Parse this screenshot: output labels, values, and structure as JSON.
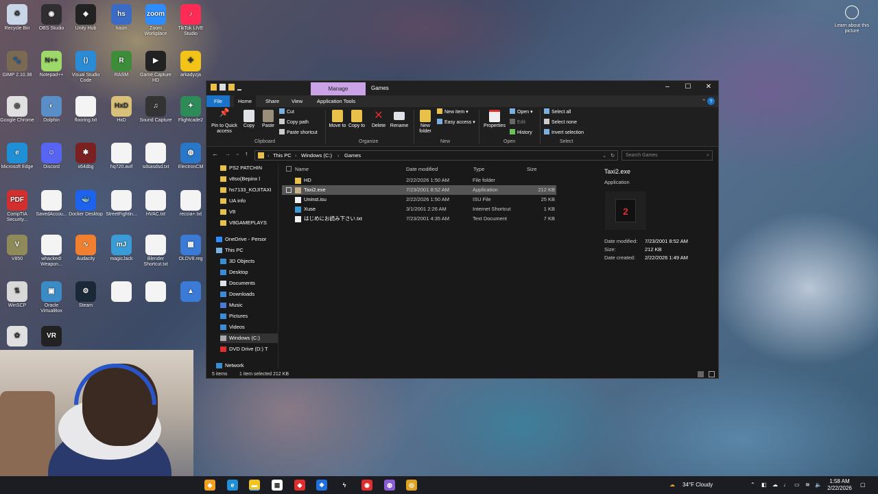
{
  "desktop": {
    "icons": [
      {
        "label": "Recycle Bin",
        "color": "#c9d6e8",
        "glyph": "♻"
      },
      {
        "label": "OBS Studio",
        "color": "#302e31",
        "glyph": "◉"
      },
      {
        "label": "Unity Hub",
        "color": "#222222",
        "glyph": "◈"
      },
      {
        "label": "hasm",
        "color": "#3b6bc4",
        "glyph": "hs"
      },
      {
        "label": "Zoom Workplace",
        "color": "#2d8cff",
        "glyph": "zoom"
      },
      {
        "label": "TikTok LIVE Studio",
        "color": "#fe2c55",
        "glyph": "♪"
      },
      {
        "label": "GIMP 2.10.38",
        "color": "#7a6a54",
        "glyph": "🐾"
      },
      {
        "label": "Notepad++",
        "color": "#9ed86a",
        "glyph": "N++"
      },
      {
        "label": "Visual Studio Code",
        "color": "#2a8bd6",
        "glyph": "⟨⟩"
      },
      {
        "label": "RASM",
        "color": "#3d8c3a",
        "glyph": "R"
      },
      {
        "label": "Game Capture HD",
        "color": "#222222",
        "glyph": "▶"
      },
      {
        "label": "arkadyzja",
        "color": "#f2c318",
        "glyph": "✚"
      },
      {
        "label": "Google Chrome",
        "color": "#e0e0e0",
        "glyph": "◎"
      },
      {
        "label": "Dolphin",
        "color": "#5a8ec6",
        "glyph": "◐"
      },
      {
        "label": "flooring.txt",
        "color": "#f4f4f4",
        "glyph": ""
      },
      {
        "label": "HxD",
        "color": "#d8c07a",
        "glyph": "HxD"
      },
      {
        "label": "Sound Capture",
        "color": "#333333",
        "glyph": "♫"
      },
      {
        "label": "Flightcade2",
        "color": "#2e8b57",
        "glyph": "✦"
      },
      {
        "label": "Microsoft Edge",
        "color": "#1f8fd6",
        "glyph": "e"
      },
      {
        "label": "Discord",
        "color": "#5865f2",
        "glyph": "☺"
      },
      {
        "label": "x64dbg",
        "color": "#7a2020",
        "glyph": "✱"
      },
      {
        "label": "hq720.avif",
        "color": "#f4f4f4",
        "glyph": ""
      },
      {
        "label": "sdsasdsd.txt",
        "color": "#f4f4f4",
        "glyph": ""
      },
      {
        "label": "ElectronCM",
        "color": "#2a76c8",
        "glyph": "◍"
      },
      {
        "label": "CompTIA Security...",
        "color": "#d32f2f",
        "glyph": "PDF"
      },
      {
        "label": "SavedAccou...",
        "color": "#f4f4f4",
        "glyph": ""
      },
      {
        "label": "Docker Desktop",
        "color": "#1d63ed",
        "glyph": "🐳"
      },
      {
        "label": "StreetFightin...",
        "color": "#f4f4f4",
        "glyph": ""
      },
      {
        "label": "HVAC.txt",
        "color": "#f4f4f4",
        "glyph": ""
      },
      {
        "label": "reccia+.txt",
        "color": "#f4f4f4",
        "glyph": ""
      },
      {
        "label": "V850",
        "color": "#8f8a5a",
        "glyph": "V"
      },
      {
        "label": "whacked! Weapon...",
        "color": "#f4f4f4",
        "glyph": ""
      },
      {
        "label": "Audacity",
        "color": "#f08030",
        "glyph": "∿"
      },
      {
        "label": "magicJack",
        "color": "#3b9bd6",
        "glyph": "mJ"
      },
      {
        "label": "Blender Shortcut.txt",
        "color": "#f4f4f4",
        "glyph": ""
      },
      {
        "label": "OLDV8.reg",
        "color": "#3b7bd6",
        "glyph": "▦"
      },
      {
        "label": "WinSCP",
        "color": "#d8d8d8",
        "glyph": "⇅"
      },
      {
        "label": "Oracle VirtualBox",
        "color": "#3b8cc6",
        "glyph": "▣"
      },
      {
        "label": "Steam",
        "color": "#1b2838",
        "glyph": "⚙"
      },
      {
        "label": "",
        "color": "#f4f4f4",
        "glyph": ""
      },
      {
        "label": "",
        "color": "#f4f4f4",
        "glyph": ""
      },
      {
        "label": "",
        "color": "#3b7bd6",
        "glyph": "▲"
      },
      {
        "label": "",
        "color": "#e0e0e0",
        "glyph": "✿"
      },
      {
        "label": "",
        "color": "#222222",
        "glyph": "VR"
      }
    ],
    "learn_label": "Learn about this picture"
  },
  "explorer": {
    "context_tab": "Manage",
    "title": "Games",
    "tabs": [
      "File",
      "Home",
      "Share",
      "View",
      "Application Tools"
    ],
    "ribbon": {
      "pin": "Pin to Quick access",
      "copy": "Copy",
      "paste": "Paste",
      "cut": "Cut",
      "copy_path": "Copy path",
      "paste_shortcut": "Paste shortcut",
      "move_to": "Move to",
      "copy_to": "Copy to",
      "delete": "Delete",
      "rename": "Rename",
      "new_folder": "New folder",
      "new_item": "New item",
      "easy_access": "Easy access",
      "properties": "Properties",
      "open": "Open",
      "edit": "Edit",
      "history": "History",
      "select_all": "Select all",
      "select_none": "Select none",
      "invert_selection": "Invert selection",
      "groups": [
        "Clipboard",
        "Organize",
        "New",
        "Open",
        "Select"
      ]
    },
    "address": {
      "crumbs": [
        "This PC",
        "Windows (C:)",
        "Games"
      ],
      "search_placeholder": "Search Games"
    },
    "nav": [
      {
        "label": "PS2 PATCHIN",
        "indent": 1,
        "icon": "folder"
      },
      {
        "label": "v8so(Bepinx l",
        "indent": 1,
        "icon": "folder"
      },
      {
        "label": "hs7133_KOJITAXI",
        "indent": 1,
        "icon": "folder"
      },
      {
        "label": "UA info",
        "indent": 1,
        "icon": "folder"
      },
      {
        "label": "V8",
        "indent": 1,
        "icon": "folder"
      },
      {
        "label": "V8GAMEPLAYS",
        "indent": 1,
        "icon": "folder"
      },
      {
        "label": "OneDrive - Persor",
        "indent": 0,
        "icon": "cloud"
      },
      {
        "label": "This PC",
        "indent": 0,
        "icon": "pc"
      },
      {
        "label": "3D Objects",
        "indent": 1,
        "icon": "blue"
      },
      {
        "label": "Desktop",
        "indent": 1,
        "icon": "blue"
      },
      {
        "label": "Documents",
        "indent": 1,
        "icon": "doc"
      },
      {
        "label": "Downloads",
        "indent": 1,
        "icon": "blue"
      },
      {
        "label": "Music",
        "indent": 1,
        "icon": "music"
      },
      {
        "label": "Pictures",
        "indent": 1,
        "icon": "blue"
      },
      {
        "label": "Videos",
        "indent": 1,
        "icon": "blue"
      },
      {
        "label": "Windows (C:)",
        "indent": 1,
        "icon": "drive"
      },
      {
        "label": "DVD Drive (D:) T",
        "indent": 1,
        "icon": "dvd"
      },
      {
        "label": "Network",
        "indent": 0,
        "icon": "net"
      }
    ],
    "columns": [
      "Name",
      "Date modified",
      "Type",
      "Size"
    ],
    "files": [
      {
        "name": "HD",
        "date": "2/22/2026 1:50 AM",
        "type": "File folder",
        "size": "",
        "icon": "folder"
      },
      {
        "name": "Taxi2.exe",
        "date": "7/23/2001 8:52 AM",
        "type": "Application",
        "size": "212 KB",
        "icon": "exe"
      },
      {
        "name": "Uninst.isu",
        "date": "2/22/2026 1:50 AM",
        "type": "ISU File",
        "size": "25 KB",
        "icon": "file"
      },
      {
        "name": "Xuse",
        "date": "3/1/2001 2:26 AM",
        "type": "Internet Shortcut",
        "size": "1 KB",
        "icon": "web"
      },
      {
        "name": "はじめにお読み下さい.txt",
        "date": "7/23/2001 4:35 AM",
        "type": "Text Document",
        "size": "7 KB",
        "icon": "txt"
      }
    ],
    "preview": {
      "name": "Taxi2.exe",
      "type": "Application",
      "details": [
        {
          "k": "Date modified:",
          "v": "7/23/2001 8:52 AM"
        },
        {
          "k": "Size:",
          "v": "212 KB"
        },
        {
          "k": "Date created:",
          "v": "2/22/2026 1:49 AM"
        }
      ]
    },
    "status": {
      "items": "5 items",
      "selected": "1 item selected  212 KB"
    }
  },
  "taskbar": {
    "weather": "34°F  Cloudy",
    "time": "1:58 AM",
    "date": "2/22/2026",
    "apps": [
      {
        "name": "start",
        "color": "#f2a11f",
        "glyph": "◆"
      },
      {
        "name": "edge",
        "color": "#1f8fd6",
        "glyph": "e"
      },
      {
        "name": "file-explorer",
        "color": "#f2c318",
        "glyph": "▬"
      },
      {
        "name": "store",
        "color": "#ffffff",
        "glyph": "▦"
      },
      {
        "name": "app-red",
        "color": "#e02d2d",
        "glyph": "◆"
      },
      {
        "name": "dropbox",
        "color": "#1f6fe0",
        "glyph": "❖"
      },
      {
        "name": "app-bolt",
        "color": "#1c1d22",
        "glyph": "ϟ"
      },
      {
        "name": "obs",
        "color": "#e02d2d",
        "glyph": "◉"
      },
      {
        "name": "app-purple",
        "color": "#8a5cd6",
        "glyph": "◍"
      },
      {
        "name": "chrome",
        "color": "#e0a020",
        "glyph": "◎"
      }
    ]
  }
}
